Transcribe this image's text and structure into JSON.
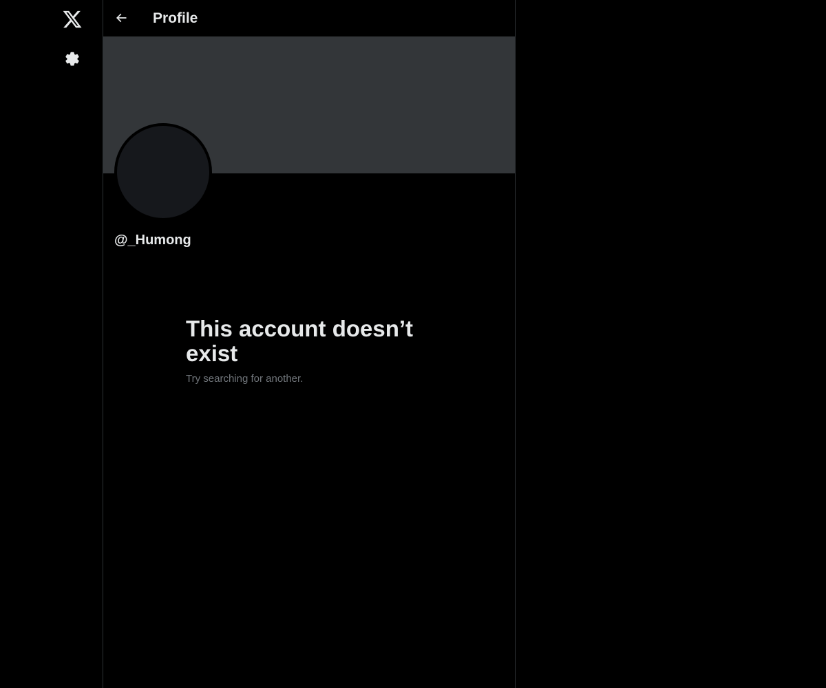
{
  "nav": {
    "logo_icon": "x-logo-icon",
    "settings_icon": "gear-icon"
  },
  "header": {
    "back_icon": "arrow-left-icon",
    "title": "Profile"
  },
  "profile": {
    "handle": "@_Humong"
  },
  "empty_state": {
    "title": "This account doesn’t exist",
    "subtitle": "Try searching for another."
  },
  "colors": {
    "background": "#000000",
    "banner": "#333639",
    "avatar": "#16181c",
    "text_primary": "#e7e9ea",
    "text_secondary": "#71767b",
    "border": "#2f3336"
  }
}
